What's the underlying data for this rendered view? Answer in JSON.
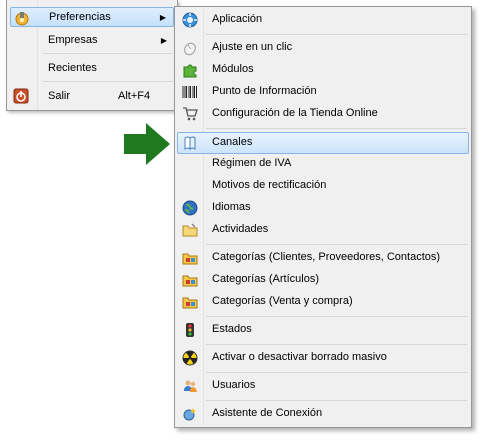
{
  "colors": {
    "highlight_border": "#86b4e8",
    "arrow": "#1f7a1f",
    "menu_bg": "#f0f0f0"
  },
  "main_menu": {
    "items": [
      {
        "label": "Preferencias",
        "icon": "tools-icon",
        "has_submenu": true,
        "highlighted": true
      },
      {
        "label": "Empresas",
        "has_submenu": true
      },
      {
        "label": "Recientes"
      },
      {
        "label": "Salir",
        "icon": "power-icon",
        "shortcut": "Alt+F4"
      }
    ]
  },
  "submenu": {
    "items": [
      {
        "label": "Aplicación",
        "icon": "gear-app-icon"
      },
      {
        "label": "Ajuste en un clic",
        "icon": "mouse-icon"
      },
      {
        "label": "Módulos",
        "icon": "puzzle-icon"
      },
      {
        "label": "Punto de Información",
        "icon": "barcode-icon"
      },
      {
        "label": "Configuración de la Tienda Online",
        "icon": "cart-icon"
      },
      {
        "label": "Canales",
        "icon": "book-icon",
        "highlighted": true
      },
      {
        "label": "Régimen de IVA"
      },
      {
        "label": "Motivos de rectificación"
      },
      {
        "label": "Idiomas",
        "icon": "globe-icon"
      },
      {
        "label": "Actividades",
        "icon": "folder-icon"
      },
      {
        "label": "Categorías (Clientes, Proveedores, Contactos)",
        "icon": "category-folder-icon"
      },
      {
        "label": "Categorías (Artículos)",
        "icon": "category-folder-icon"
      },
      {
        "label": "Categorías (Venta y compra)",
        "icon": "category-folder-icon"
      },
      {
        "label": "Estados",
        "icon": "traffic-light-icon"
      },
      {
        "label": "Activar o desactivar borrado masivo",
        "icon": "radiation-icon"
      },
      {
        "label": "Usuarios",
        "icon": "users-icon"
      },
      {
        "label": "Asistente de Conexión",
        "icon": "wizard-icon"
      }
    ]
  }
}
